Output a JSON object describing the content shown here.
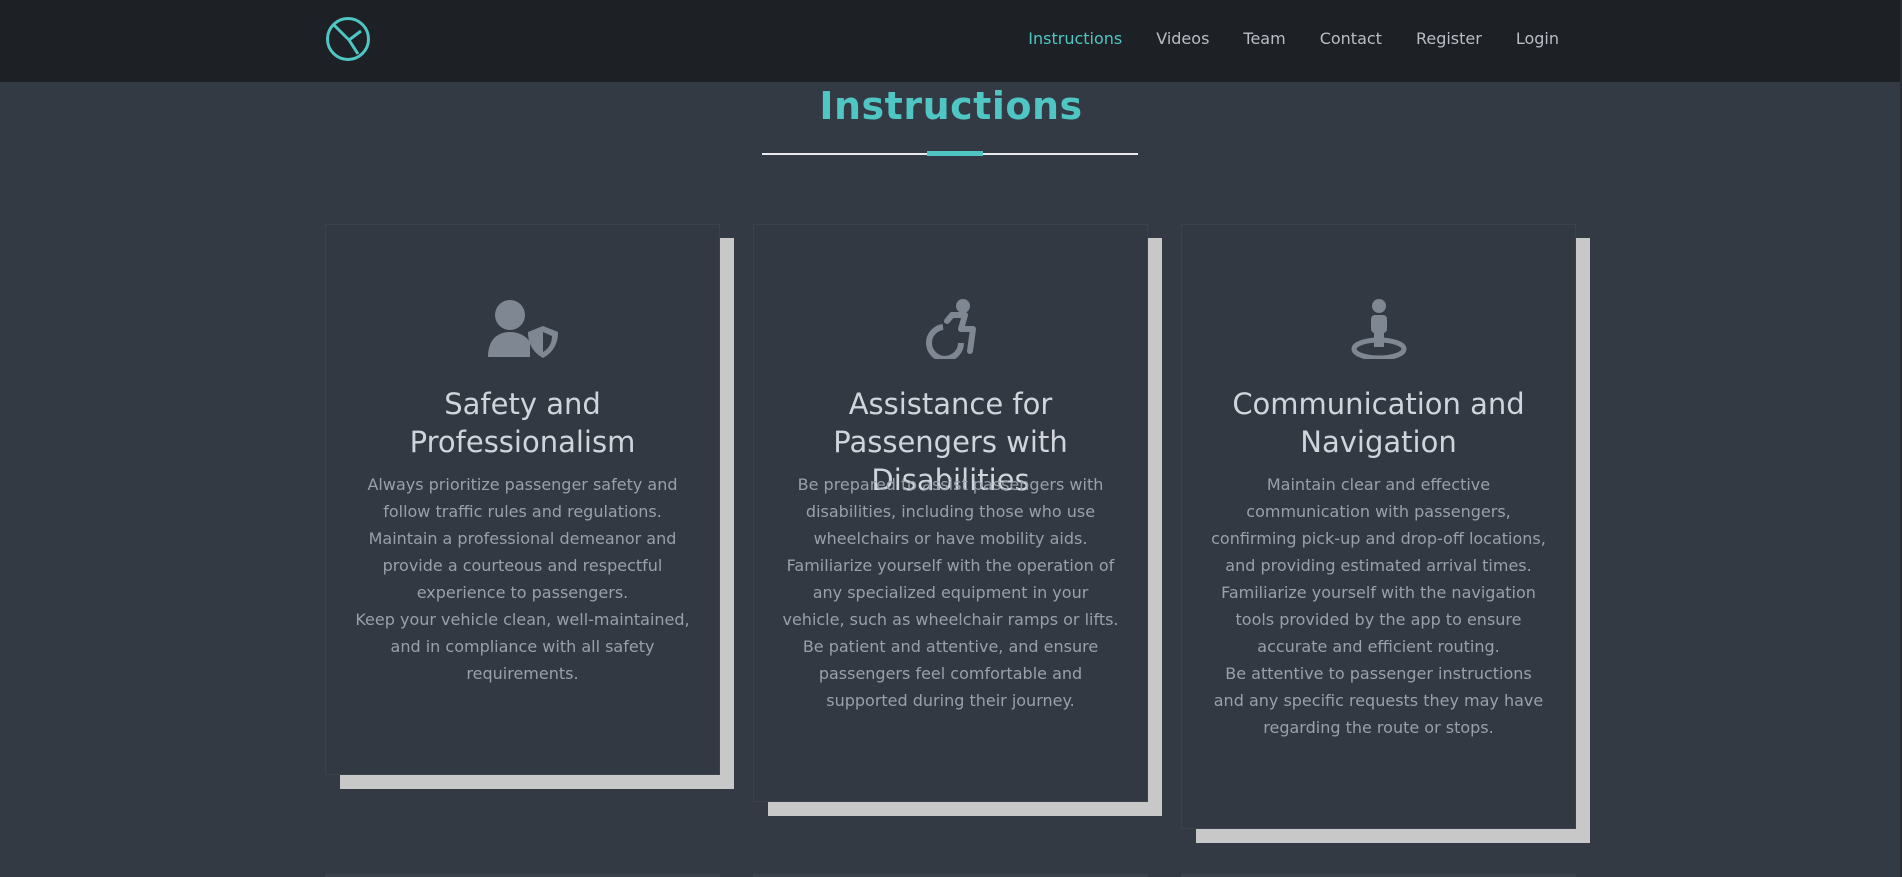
{
  "nav": {
    "links": [
      "Instructions",
      "Videos",
      "Team",
      "Contact",
      "Register",
      "Login"
    ],
    "active": "Instructions"
  },
  "section": {
    "title": "Instructions"
  },
  "cards": [
    {
      "icon": "user-shield-icon",
      "title": "Safety and Professionalism",
      "paragraphs": [
        "Always prioritize passenger safety and follow traffic rules and regulations.",
        "Maintain a professional demeanor and provide a courteous and respectful experience to passengers.",
        "Keep your vehicle clean, well-maintained, and in compliance with all safety requirements."
      ]
    },
    {
      "icon": "wheelchair-icon",
      "title": "Assistance for Passengers with Disabilities",
      "paragraphs": [
        "Be prepared to assist passengers with disabilities, including those who use wheelchairs or have mobility aids.",
        "Familiarize yourself with the operation of any specialized equipment in your vehicle, such as wheelchair ramps or lifts.",
        "Be patient and attentive, and ensure passengers feel comfortable and supported during their journey."
      ]
    },
    {
      "icon": "person-location-icon",
      "title": "Communication and Navigation",
      "paragraphs": [
        "Maintain clear and effective communication with passengers, confirming pick-up and drop-off locations, and providing estimated arrival times.",
        "Familiarize yourself with the navigation tools provided by the app to ensure accurate and efficient routing.",
        "Be attentive to passenger instructions and any specific requests they may have regarding the route or stops."
      ]
    }
  ],
  "colors": {
    "accent": "#4fc6c3",
    "navbar": "#1d2025",
    "background": "#343a43",
    "card_shadow": "#c8c8c8",
    "icon": "#7f8793"
  }
}
